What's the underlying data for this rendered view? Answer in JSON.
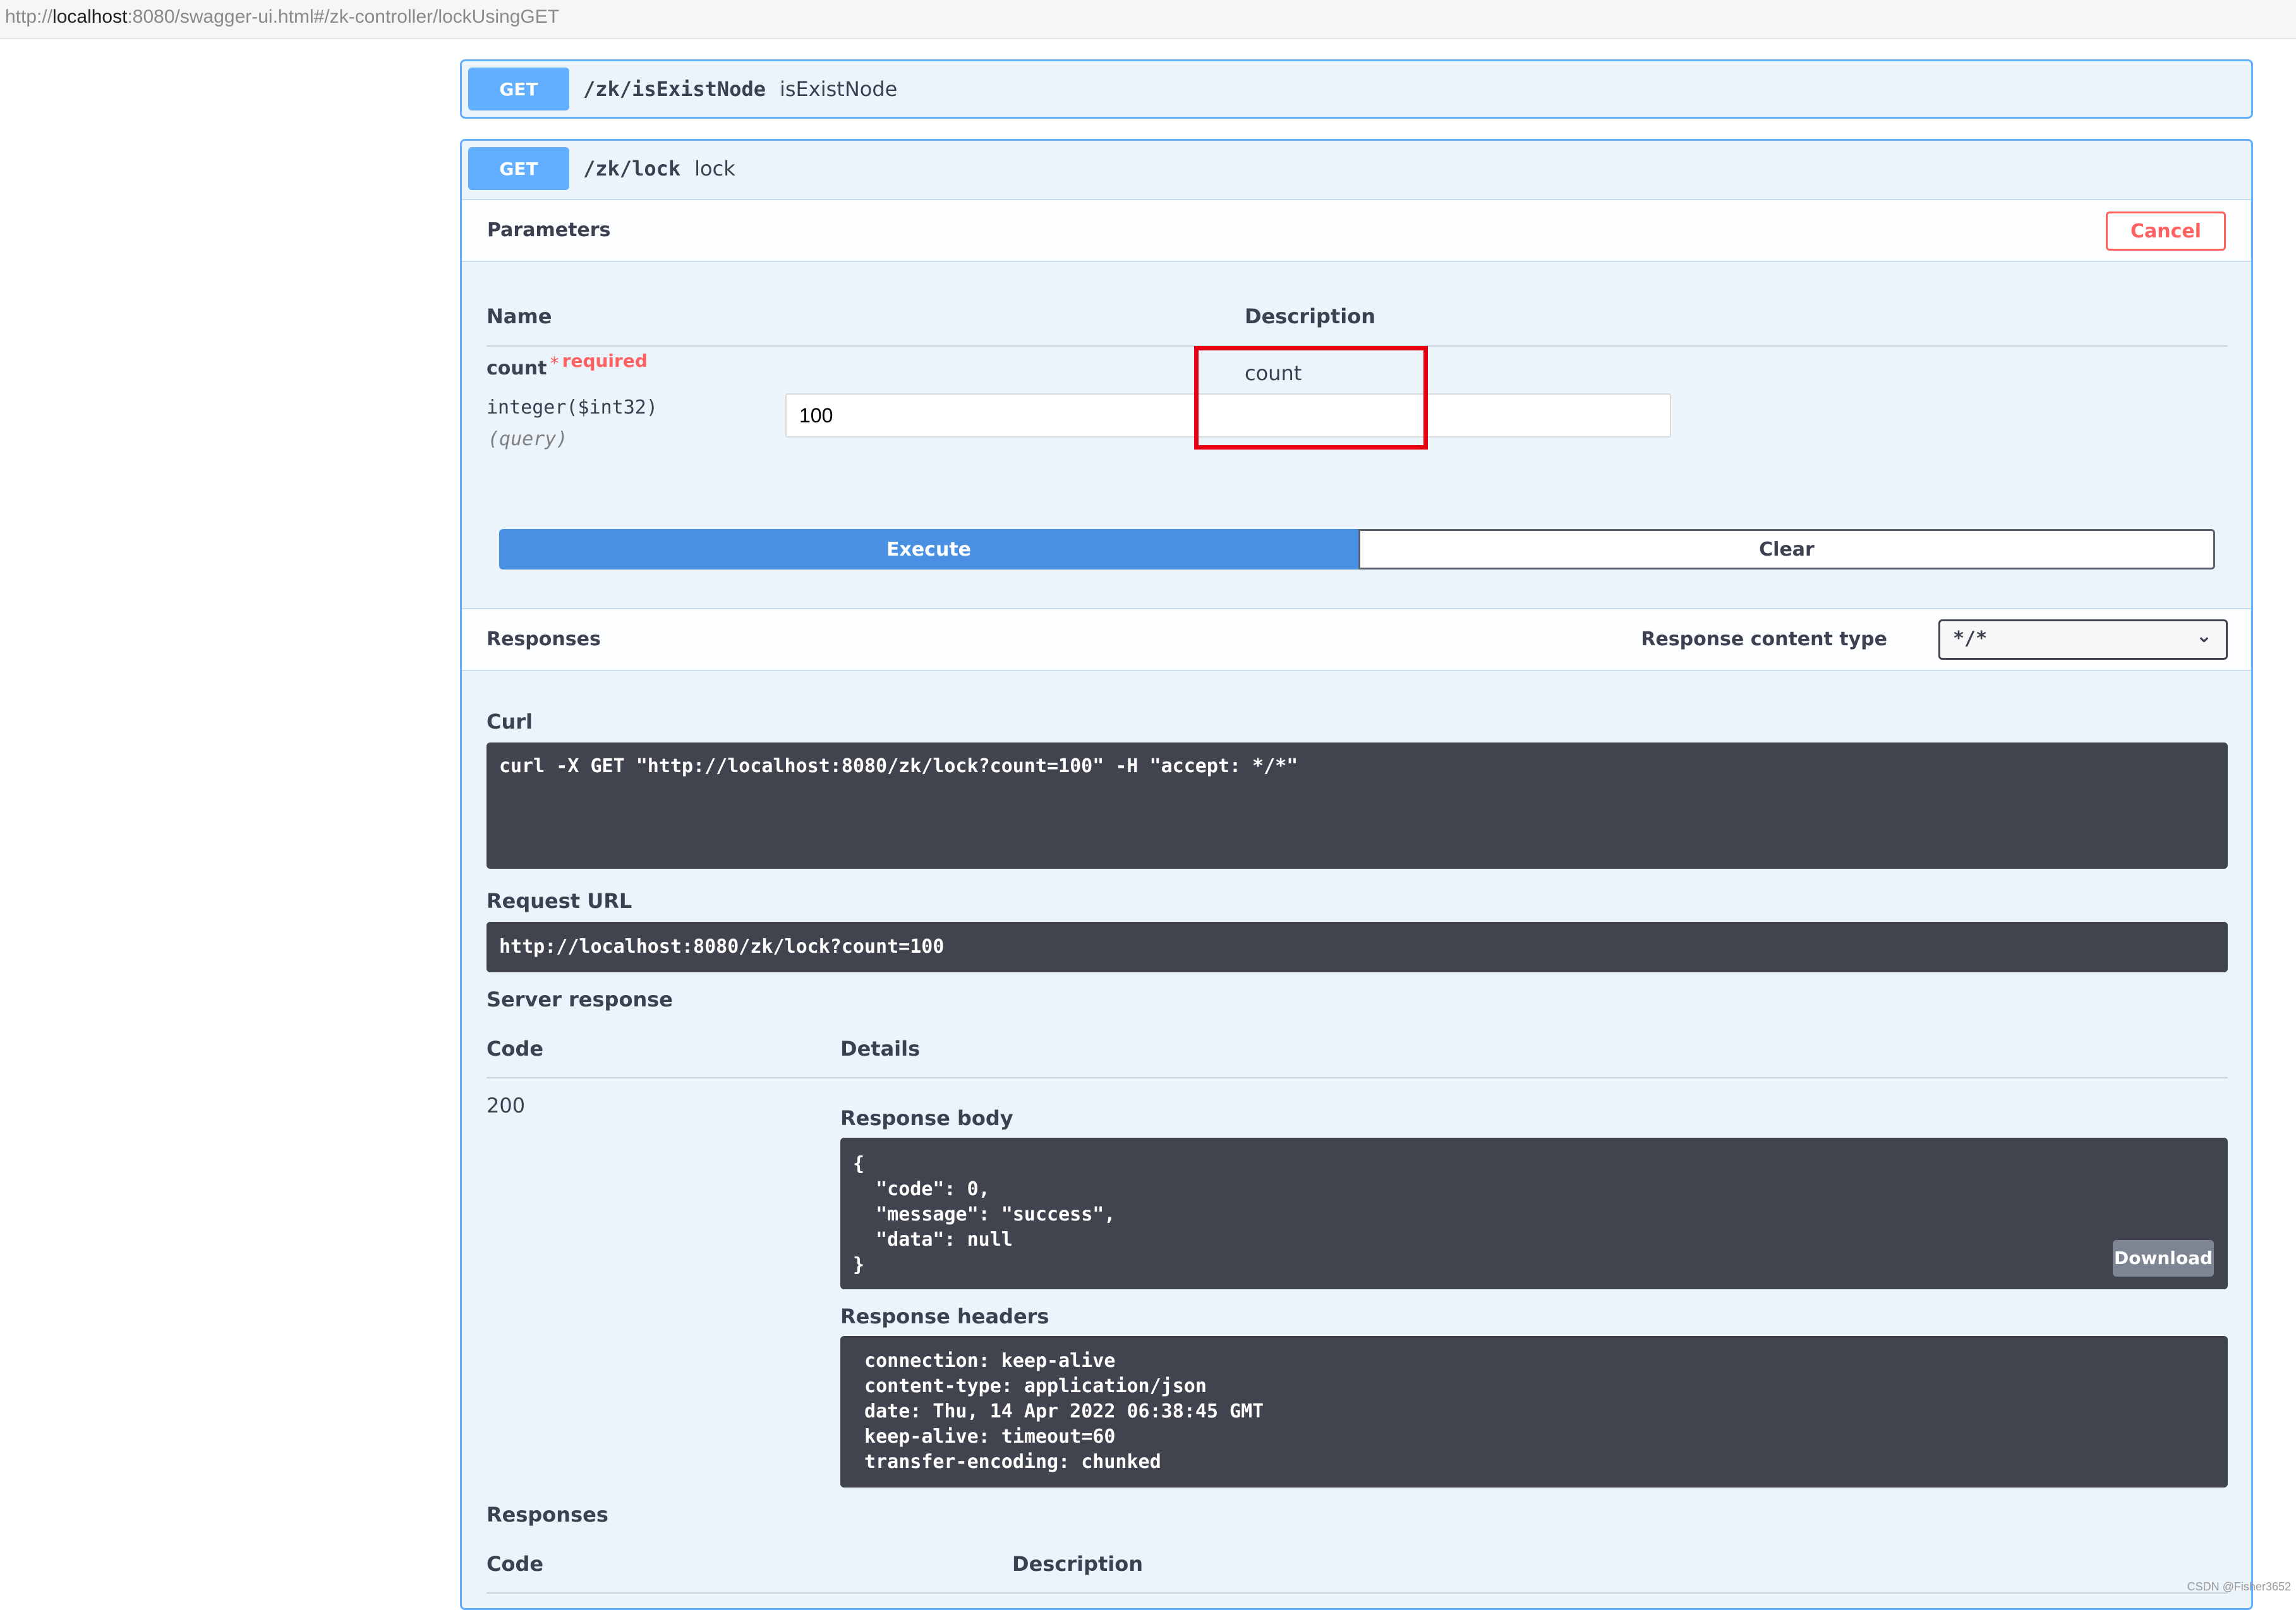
{
  "browser": {
    "url_prefix": "http://",
    "url_host": "localhost",
    "url_rest": ":8080/swagger-ui.html#/zk-controller/lockUsingGET"
  },
  "op_exist": {
    "method": "GET",
    "path": "/zk/isExistNode",
    "summary": "isExistNode"
  },
  "op_lock": {
    "method": "GET",
    "path": "/zk/lock",
    "summary": "lock",
    "parameters_title": "Parameters",
    "cancel_label": "Cancel",
    "col_name": "Name",
    "col_description": "Description",
    "param": {
      "name": "count",
      "required_star": "*",
      "required_label": "required",
      "type": "integer($int32)",
      "in": "(query)",
      "description": "count",
      "value": "100"
    },
    "execute_label": "Execute",
    "clear_label": "Clear",
    "responses_title": "Responses",
    "content_type_label": "Response content type",
    "content_type_value": "*/*",
    "curl_label": "Curl",
    "curl_command": "curl -X GET \"http://localhost:8080/zk/lock?count=100\" -H \"accept: */*\"",
    "request_url_label": "Request URL",
    "request_url": "http://localhost:8080/zk/lock?count=100",
    "server_response_label": "Server response",
    "col_code": "Code",
    "col_details": "Details",
    "response_code": "200",
    "response_body_label": "Response body",
    "response_body": "{\n  \"code\": 0,\n  \"message\": \"success\",\n  \"data\": null\n}",
    "download_label": "Download",
    "response_headers_label": "Response headers",
    "response_headers": " connection: keep-alive\n content-type: application/json\n date: Thu, 14 Apr 2022 06:38:45 GMT\n keep-alive: timeout=60\n transfer-encoding: chunked",
    "responses_bottom_label": "Responses",
    "bottom_col_code": "Code",
    "bottom_col_description": "Description"
  },
  "watermark": "CSDN @Fisher3652",
  "colors": {
    "get_accent": "#61affe",
    "execute_blue": "#4990e2",
    "cancel_red": "#ff6060",
    "code_bg": "#41444e",
    "highlight_red": "#e60012"
  }
}
